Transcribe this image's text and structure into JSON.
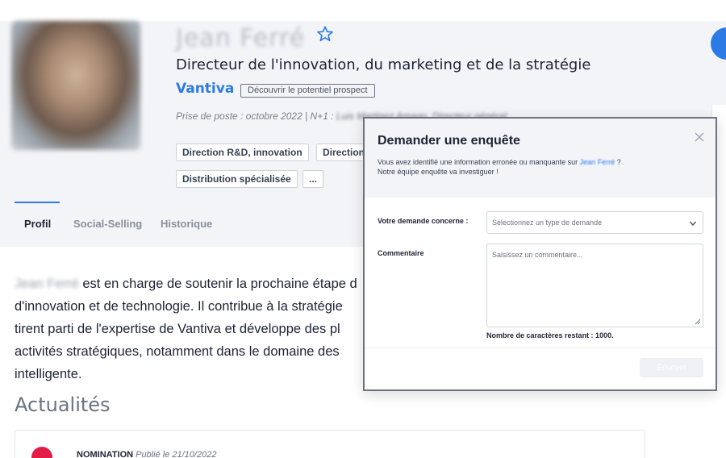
{
  "profile": {
    "name": "Jean Ferré",
    "job_title": "Directeur de l'innovation, du marketing et de la stratégie",
    "company": "Vantiva",
    "prospect_button": "Découvrir le potentiel prospect",
    "meta_prefix": "Prise de poste : octobre 2022 | N+1 : ",
    "meta_manager": "Luis Martinez Amago, Directeur général",
    "tags": [
      "Direction R&D, innovation",
      "Direction",
      "Distribution spécialisée",
      "..."
    ]
  },
  "tabs": [
    {
      "label": "Profil",
      "active": true
    },
    {
      "label": "Social-Selling",
      "active": false
    },
    {
      "label": "Historique",
      "active": false
    }
  ],
  "bio": {
    "name": "Jean Ferré",
    "lines": [
      " est en charge de soutenir la prochaine étape d",
      "d'innovation et de technologie. Il contribue à la stratégie",
      "tirent parti de l'expertise de Vantiva et développe des pl",
      "activités stratégiques, notamment dans le domaine des",
      "intelligente."
    ]
  },
  "news": {
    "section_title": "Actualités",
    "type": "NOMINATION",
    "published": "Publié le 21/10/2022"
  },
  "modal": {
    "title": "Demander une enquête",
    "desc_prefix": "Vous avez identifié une information erronée ou manquante sur ",
    "desc_link": "Jean Ferré",
    "desc_suffix": " ?",
    "desc_line2": "Notre équipe enquête va investiguer !",
    "request_label": "Votre demande concerne :",
    "request_placeholder": "Sélectionnez un type de demande",
    "comment_label": "Commentaire",
    "comment_placeholder": "Saisissez un commentaire...",
    "char_count": "Nombre de caractères restant : 1000.",
    "send_label": "Envoyer"
  },
  "colors": {
    "accent": "#2c7be5",
    "news_badge": "#e11d48"
  },
  "icons": {
    "favorite": "star-outline-icon",
    "close": "close-icon",
    "dropdown": "chevron-down-icon"
  }
}
